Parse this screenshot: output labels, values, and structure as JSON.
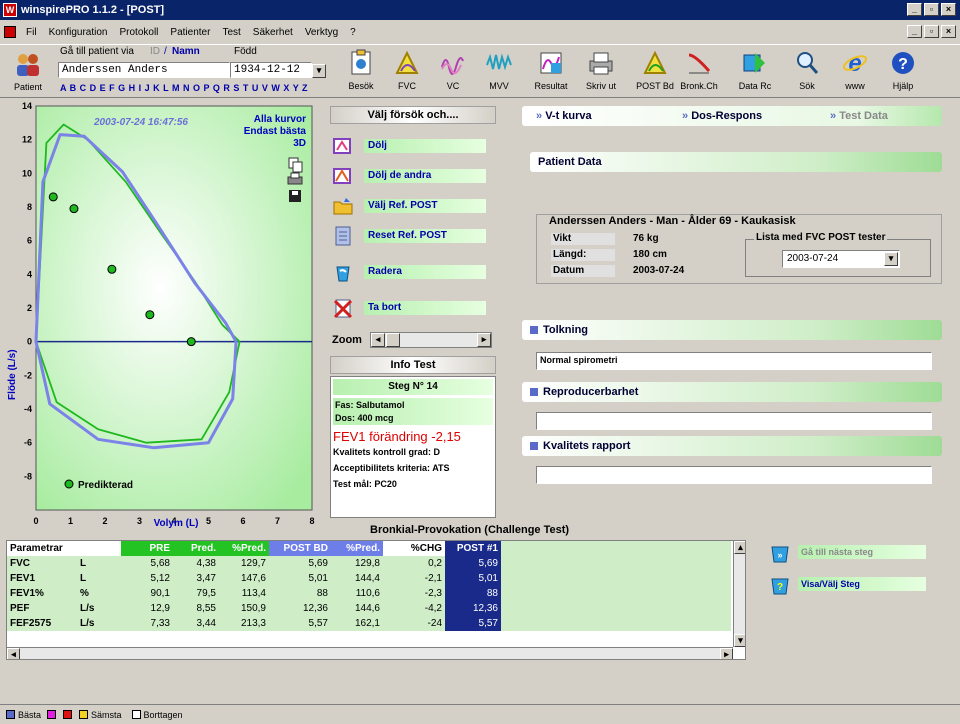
{
  "window": {
    "title": "winspirePRO 1.1.2 - [POST]"
  },
  "menu": [
    "Fil",
    "Konfiguration",
    "Protokoll",
    "Patienter",
    "Test",
    "Säkerhet",
    "Verktyg",
    "?"
  ],
  "patient": {
    "label": "Patient",
    "goto_label": "Gå till patient via",
    "id_link": "ID",
    "slash": "/",
    "name_link": "Namn",
    "born_label": "Född",
    "name_value": "Anderssen Anders",
    "dob_value": "1934-12-12",
    "alphabet": "A B C D E F G H I J K L M N O P Q R S T U V W X Y Z"
  },
  "toolbar": [
    {
      "label": "Besök",
      "icon": "visit-icon"
    },
    {
      "label": "FVC",
      "icon": "fvc-icon"
    },
    {
      "label": "VC",
      "icon": "vc-icon"
    },
    {
      "label": "MVV",
      "icon": "mvv-icon"
    },
    {
      "label": "Resultat",
      "icon": "results-icon"
    },
    {
      "label": "Skriv ut",
      "icon": "printer-icon"
    },
    {
      "label": "POST Bd",
      "icon": "post-bd-icon"
    },
    {
      "label": "Bronk.Ch",
      "icon": "bronk-ch-icon"
    },
    {
      "label": "Data Rc",
      "icon": "data-rc-icon"
    },
    {
      "label": "Sök",
      "icon": "search-icon"
    },
    {
      "label": "www",
      "icon": "www-icon"
    },
    {
      "label": "Hjälp",
      "icon": "help-icon"
    }
  ],
  "chart_data": {
    "type": "scatter",
    "timestamp": "2003-07-24 16:47:56",
    "options": [
      "Alla kurvor",
      "Endast bästa",
      "3D"
    ],
    "xlabel": "Volym (L)",
    "ylabel": "Flöde (L/s)",
    "xlim": [
      0,
      8
    ],
    "ylim": [
      -10,
      14
    ],
    "xticks": [
      "0",
      "1",
      "2",
      "3",
      "4",
      "5",
      "6",
      "7",
      "8"
    ],
    "yticks": [
      "14",
      "12",
      "10",
      "8",
      "6",
      "4",
      "2",
      "0",
      "-2",
      "-4",
      "-6",
      "-8"
    ],
    "legend": "Predikterad",
    "series": [
      {
        "name": "curve-green",
        "color": "#1fb81f",
        "points": [
          [
            0,
            0
          ],
          [
            0.3,
            11.8
          ],
          [
            0.8,
            12.9
          ],
          [
            1.5,
            12
          ],
          [
            2.6,
            9.5
          ],
          [
            3.6,
            6.5
          ],
          [
            4.6,
            3.6
          ],
          [
            5.4,
            1.0
          ],
          [
            5.9,
            0
          ],
          [
            5.6,
            -3.0
          ],
          [
            4.8,
            -5.8
          ],
          [
            3.2,
            -6.0
          ],
          [
            1.8,
            -5.2
          ],
          [
            0.6,
            -3.6
          ],
          [
            0,
            0
          ]
        ]
      },
      {
        "name": "curve-blue",
        "color": "#7b82e8",
        "points": [
          [
            0,
            0
          ],
          [
            0.2,
            9.5
          ],
          [
            0.7,
            12.3
          ],
          [
            1.4,
            12.2
          ],
          [
            2.5,
            10.1
          ],
          [
            3.5,
            7.0
          ],
          [
            4.6,
            3.5
          ],
          [
            5.5,
            1.1
          ],
          [
            5.8,
            0
          ],
          [
            5.7,
            -3.4
          ],
          [
            5.0,
            -6.0
          ],
          [
            3.4,
            -6.3
          ],
          [
            1.8,
            -5.8
          ],
          [
            0.4,
            -3.7
          ],
          [
            0,
            0
          ]
        ]
      },
      {
        "name": "predicted",
        "color": "#1fb81f",
        "points": [
          [
            0.5,
            8.6
          ],
          [
            1.1,
            7.9
          ],
          [
            2.2,
            4.3
          ],
          [
            3.3,
            1.6
          ],
          [
            4.5,
            0
          ]
        ]
      }
    ]
  },
  "actions": {
    "header": "Välj försök och....",
    "items": [
      {
        "label": "Dölj",
        "icon": "hide-icon"
      },
      {
        "label": "Dölj de andra",
        "icon": "hide-others-icon"
      },
      {
        "label": "Välj Ref. POST",
        "icon": "folder-icon"
      },
      {
        "label": "Reset Ref. POST",
        "icon": "reset-icon"
      },
      {
        "label": "Radera",
        "icon": "recycle-icon"
      },
      {
        "label": "Ta bort",
        "icon": "delete-icon"
      }
    ],
    "zoom_label": "Zoom"
  },
  "info": {
    "header": "Info Test",
    "step": "Steg N° 14",
    "phase": "Fas: Salbutamol",
    "dose": "Dos: 400 mcg",
    "fev1": "FEV1 förändring -2,15",
    "quality": "Kvalitets kontroll grad: D",
    "acceptability": "Acceptibilitets kriteria: ATS",
    "target": "Test mål: PC20"
  },
  "tabs": [
    "V-t kurva",
    "Dos-Respons",
    "Test Data"
  ],
  "patient_data": {
    "header": "Patient Data",
    "title": "Anderssen Anders - Man - Ålder 69 - Kaukasisk",
    "rows": [
      {
        "label": "Vikt",
        "value": "76 kg"
      },
      {
        "label": "Längd:",
        "value": "180 cm"
      },
      {
        "label": "Datum",
        "value": "2003-07-24"
      }
    ],
    "list_label": "Lista med FVC POST tester",
    "list_value": "2003-07-24"
  },
  "sections": {
    "interpretation": "Tolkning",
    "interpretation_value": "Normal spirometri",
    "reproducibility": "Reproducerbarhet",
    "quality_report": "Kvalitets rapport"
  },
  "table": {
    "title": "Bronkial-Provokation (Challenge Test)",
    "headers": [
      "Parametrar",
      "",
      "PRE",
      "Pred.",
      "%Pred.",
      "POST BD",
      "%Pred.",
      "%CHG",
      "POST #1"
    ],
    "rows": [
      [
        "FVC",
        "L",
        "5,68",
        "4,38",
        "129,7",
        "5,69",
        "129,8",
        "0,2",
        "5,69"
      ],
      [
        "FEV1",
        "L",
        "5,12",
        "3,47",
        "147,6",
        "5,01",
        "144,4",
        "-2,1",
        "5,01"
      ],
      [
        "FEV1%",
        "%",
        "90,1",
        "79,5",
        "113,4",
        "88",
        "110,6",
        "-2,3",
        "88"
      ],
      [
        "PEF",
        "L/s",
        "12,9",
        "8,55",
        "150,9",
        "12,36",
        "144,6",
        "-4,2",
        "12,36"
      ],
      [
        "FEF2575",
        "L/s",
        "7,33",
        "3,44",
        "213,3",
        "5,57",
        "162,1",
        "-24",
        "5,57"
      ]
    ]
  },
  "side_actions": [
    "Gå till nästa steg",
    "Visa/Välj Steg"
  ],
  "status": {
    "best": "Bästa",
    "worst": "Sämsta",
    "removed": "Borttagen"
  }
}
